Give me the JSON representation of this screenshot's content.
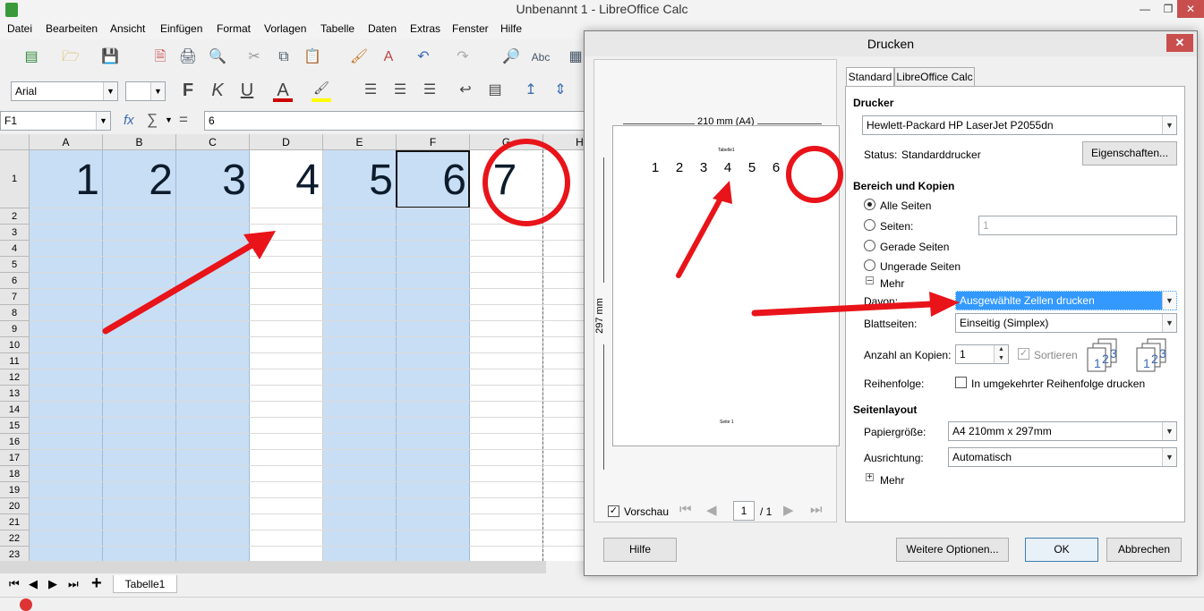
{
  "window": {
    "title": "Unbenannt 1 - LibreOffice Calc"
  },
  "menu": [
    "Datei",
    "Bearbeiten",
    "Ansicht",
    "Einfügen",
    "Format",
    "Vorlagen",
    "Tabelle",
    "Daten",
    "Extras",
    "Fenster",
    "Hilfe"
  ],
  "format_toolbar": {
    "font_name": "Arial",
    "font_size": "",
    "bold": "F",
    "italic": "K",
    "underline": "U",
    "font_color": "A"
  },
  "formula_bar": {
    "cell_ref": "F1",
    "fx": "fx",
    "sigma": "∑",
    "equals": "=",
    "content": "6"
  },
  "sheet": {
    "columns": [
      "A",
      "B",
      "C",
      "D",
      "E",
      "F",
      "G",
      "H"
    ],
    "rows": [
      "1",
      "2",
      "3",
      "4",
      "5",
      "6",
      "7",
      "8",
      "9",
      "10",
      "11",
      "12",
      "13",
      "14",
      "15",
      "16",
      "17",
      "18",
      "19",
      "20",
      "21",
      "22",
      "23"
    ],
    "row1_values": [
      "1",
      "2",
      "3",
      "4",
      "5",
      "6",
      "7"
    ],
    "tab_name": "Tabelle1"
  },
  "dialog": {
    "title": "Drucken",
    "preview": {
      "width_label": "210 mm (A4)",
      "height_label": "297 mm",
      "page_header": "Tabelle1",
      "page_footer": "Seite 1",
      "numbers": [
        "1",
        "2",
        "3",
        "4",
        "5",
        "6"
      ],
      "preview_label": "Vorschau",
      "page_current": "1",
      "page_total": "/ 1"
    },
    "tabs": [
      "Standard",
      "LibreOffice Calc"
    ],
    "printer": {
      "heading": "Drucker",
      "name": "Hewlett-Packard HP LaserJet P2055dn",
      "status_label": "Status:",
      "status_value": "Standarddrucker",
      "properties_button": "Eigenschaften..."
    },
    "range": {
      "heading": "Bereich und Kopien",
      "all_pages": "Alle Seiten",
      "pages": "Seiten:",
      "pages_value": "1",
      "even_pages": "Gerade Seiten",
      "odd_pages": "Ungerade Seiten",
      "more": "Mehr",
      "of_which_label": "Davon:",
      "of_which_value": "Ausgewählte Zellen drucken",
      "sides_label": "Blattseiten:",
      "sides_value": "Einseitig (Simplex)",
      "copies_label": "Anzahl an Kopien:",
      "copies_value": "1",
      "collate": "Sortieren",
      "order_label": "Reihenfolge:",
      "reverse_order": "In umgekehrter Reihenfolge drucken"
    },
    "layout": {
      "heading": "Seitenlayout",
      "paper_size_label": "Papiergröße:",
      "paper_size_value": "A4 210mm x 297mm",
      "orientation_label": "Ausrichtung:",
      "orientation_value": "Automatisch",
      "more": "Mehr"
    },
    "buttons": {
      "help": "Hilfe",
      "more_options": "Weitere Optionen...",
      "ok": "OK",
      "cancel": "Abbrechen"
    }
  },
  "colors": {
    "selection": "#c8def5",
    "annotation": "#e8141a",
    "highlight": "#3399ff"
  }
}
